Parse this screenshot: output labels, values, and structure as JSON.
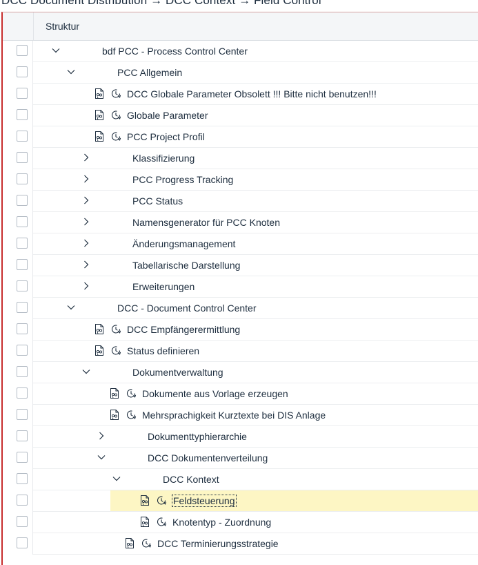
{
  "breadcrumb": "DCC Document Distribution → DCC Context → Field Control",
  "table": {
    "header_label": "Struktur",
    "rows": [
      {
        "label": "bdf PCC - Process Control Center",
        "level": 0,
        "toggle": "expanded",
        "icons": false,
        "bold_weight": true
      },
      {
        "label": "PCC Allgemein",
        "level": 1,
        "toggle": "expanded",
        "icons": false
      },
      {
        "label": "DCC Globale Parameter  Obsolett !!! Bitte nicht benutzen!!!",
        "level": 2,
        "toggle": "none",
        "icons": true
      },
      {
        "label": "Globale Parameter",
        "level": 2,
        "toggle": "none",
        "icons": true
      },
      {
        "label": "PCC Project Profil",
        "level": 2,
        "toggle": "none",
        "icons": true
      },
      {
        "label": "Klassifizierung",
        "level": 2,
        "toggle": "collapsed",
        "icons": false
      },
      {
        "label": "PCC Progress Tracking",
        "level": 2,
        "toggle": "collapsed",
        "icons": false
      },
      {
        "label": "PCC Status",
        "level": 2,
        "toggle": "collapsed",
        "icons": false
      },
      {
        "label": "Namensgenerator für PCC Knoten",
        "level": 2,
        "toggle": "collapsed",
        "icons": false
      },
      {
        "label": "Änderungsmanagement",
        "level": 2,
        "toggle": "collapsed",
        "icons": false
      },
      {
        "label": "Tabellarische Darstellung",
        "level": 2,
        "toggle": "collapsed",
        "icons": false
      },
      {
        "label": "Erweiterungen",
        "level": 2,
        "toggle": "collapsed",
        "icons": false
      },
      {
        "label": "DCC - Document Control Center",
        "level": 1,
        "toggle": "expanded",
        "icons": false
      },
      {
        "label": "DCC Empfängerermittlung",
        "level": 2,
        "toggle": "none",
        "icons": true
      },
      {
        "label": "Status definieren",
        "level": 2,
        "toggle": "none",
        "icons": true
      },
      {
        "label": "Dokumentverwaltung",
        "level": 2,
        "toggle": "expanded",
        "icons": false
      },
      {
        "label": "Dokumente aus Vorlage erzeugen",
        "level": 3,
        "toggle": "none",
        "icons": true
      },
      {
        "label": "Mehrsprachigkeit Kurztexte bei DIS Anlage",
        "level": 3,
        "toggle": "none",
        "icons": true
      },
      {
        "label": "Dokumenttyphierarchie",
        "level": 3,
        "toggle": "collapsed",
        "icons": false
      },
      {
        "label": "DCC Dokumentenverteilung",
        "level": 3,
        "toggle": "expanded",
        "icons": false
      },
      {
        "label": "DCC Kontext",
        "level": 4,
        "toggle": "expanded",
        "icons": false
      },
      {
        "label": "Feldsteuerung",
        "level": 5,
        "toggle": "none",
        "icons": true,
        "selected": true
      },
      {
        "label": "Knotentyp - Zuordnung",
        "level": 5,
        "toggle": "none",
        "icons": true
      },
      {
        "label": "DCC Terminierungsstrategie",
        "level": 4,
        "toggle": "none",
        "icons": true
      }
    ]
  },
  "colors": {
    "highlight": "#fdf6c4",
    "text": "#1d2d3e",
    "frame": "#c72c2c",
    "icon": "#1d2d3e"
  },
  "icons": {
    "doc": "documentation-icon",
    "execute": "clock-icon",
    "expanded": "chevron-down-icon",
    "collapsed": "chevron-right-icon"
  }
}
